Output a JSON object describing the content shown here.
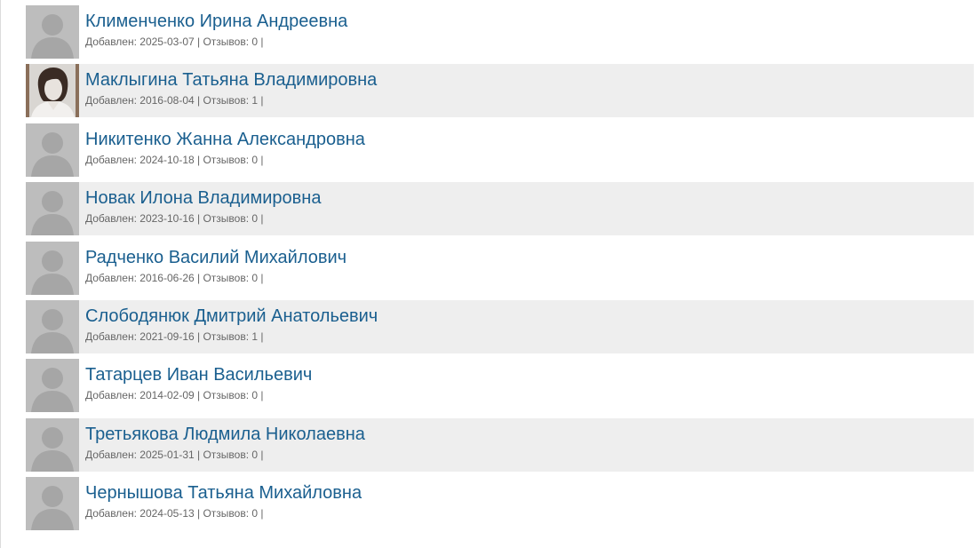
{
  "people": [
    {
      "name": "Клименченко Ирина Андреевна",
      "meta": "Добавлен: 2025-03-07 | Отзывов: 0 |",
      "avatar": "placeholder-avatar-icon"
    },
    {
      "name": "Маклыгина Татьяна Владимировна",
      "meta": "Добавлен: 2016-08-04 | Отзывов: 1 |",
      "avatar": "photo"
    },
    {
      "name": "Никитенко Жанна Александровна",
      "meta": "Добавлен: 2024-10-18 | Отзывов: 0 |",
      "avatar": "placeholder-avatar-icon"
    },
    {
      "name": "Новак Илона Владимировна",
      "meta": "Добавлен: 2023-10-16 | Отзывов: 0 |",
      "avatar": "placeholder-avatar-icon"
    },
    {
      "name": "Радченко Василий Михайлович",
      "meta": "Добавлен: 2016-06-26 | Отзывов: 0 |",
      "avatar": "placeholder-avatar-icon"
    },
    {
      "name": "Слободянюк Дмитрий Анатольевич",
      "meta": "Добавлен: 2021-09-16 | Отзывов: 1 |",
      "avatar": "placeholder-avatar-icon"
    },
    {
      "name": "Татарцев Иван Васильевич",
      "meta": "Добавлен: 2014-02-09 | Отзывов: 0 |",
      "avatar": "placeholder-avatar-icon"
    },
    {
      "name": "Третьякова Людмила Николаевна",
      "meta": "Добавлен: 2025-01-31 | Отзывов: 0 |",
      "avatar": "placeholder-avatar-icon"
    },
    {
      "name": "Чернышова Татьяна Михайловна",
      "meta": "Добавлен: 2024-05-13 | Отзывов: 0 |",
      "avatar": "placeholder-avatar-icon"
    }
  ],
  "colors": {
    "link": "#1a5f8f",
    "meta": "#666666",
    "alt_row": "#eeeeee",
    "avatar_bg": "#bdbdbd"
  }
}
